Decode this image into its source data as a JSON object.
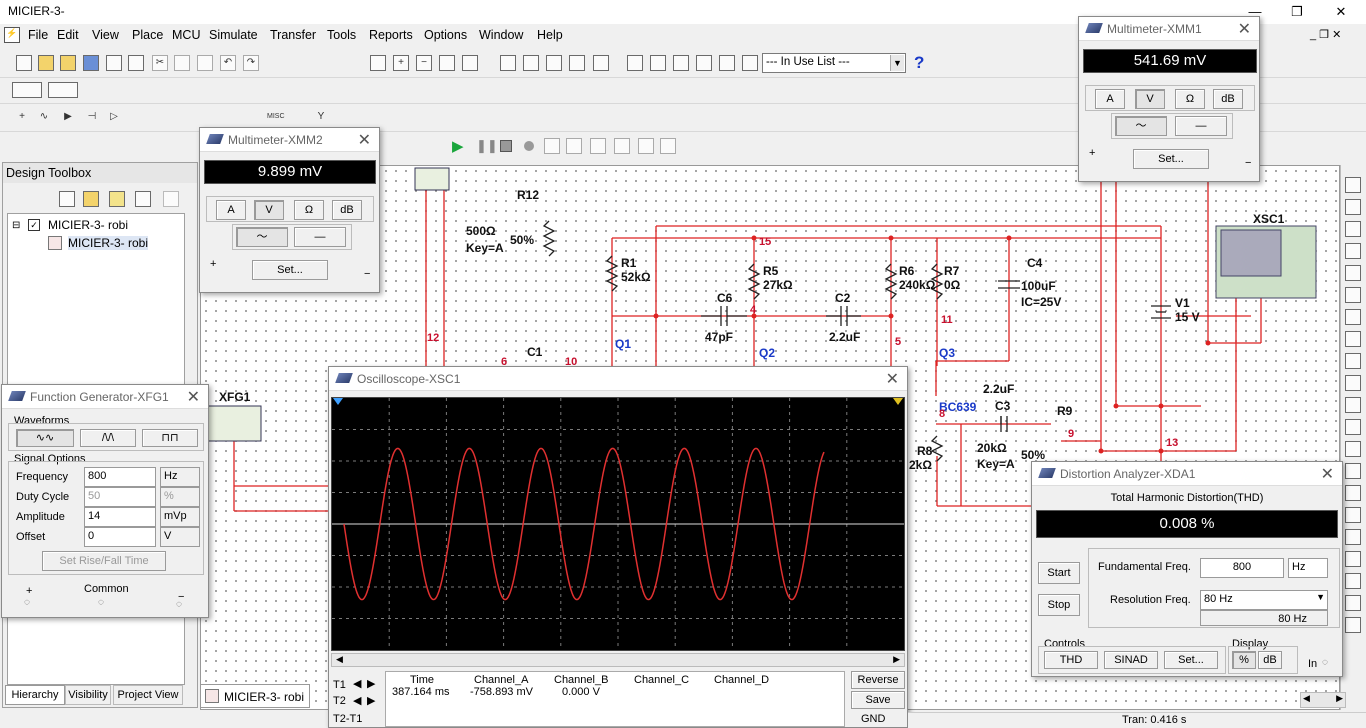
{
  "app": {
    "title": "MICIER-3-"
  },
  "menu": [
    "File",
    "Edit",
    "View",
    "Place",
    "MCU",
    "Simulate",
    "Transfer",
    "Tools",
    "Reports",
    "Options",
    "Window",
    "Help"
  ],
  "toolbar": {
    "in_use_list": "--- In Use List ---",
    "help": "?"
  },
  "toolbox": {
    "title": "Design Toolbox",
    "tree_root": "MICIER-3- robi",
    "tree_child": "MICIER-3- robi",
    "tabs": [
      "Hierarchy",
      "Visibility",
      "Project View"
    ]
  },
  "doc_tab": "MICIER-3- robi",
  "schematic": {
    "components": {
      "r12": "R12",
      "r12_val": "500Ω",
      "r12_key": "Key=A",
      "r12_pct": "50%",
      "r1": "R1",
      "r1_val": "52kΩ",
      "r5": "R5",
      "r5_val": "27kΩ",
      "r6": "R6",
      "r6_val": "240kΩ",
      "r7": "R7",
      "r7_val": "0Ω",
      "c4": "C4",
      "c4_val": "100uF",
      "c4_ic": "IC=25V",
      "c6": "C6",
      "c6_val": "47pF",
      "c2": "C2",
      "c2_val": "2.2uF",
      "c1": "C1",
      "q1": "Q1",
      "q2": "Q2",
      "q3": "Q3",
      "q3_model": "BC639",
      "v1": "V1",
      "v1_val": "15 V",
      "c3": "C3",
      "c3_val": "2.2uF",
      "r9": "R9",
      "r9_val": "20kΩ",
      "r9_key": "Key=A",
      "r9_pct": "50%",
      "r8": "R8",
      "r8_val": "2kΩ",
      "xfg1": "XFG1",
      "xsc1": "XSC1"
    },
    "nets": [
      "15",
      "4",
      "5",
      "11",
      "12",
      "6",
      "10",
      "9",
      "13",
      "8"
    ]
  },
  "xmm2": {
    "title": "Multimeter-XMM2",
    "reading": "9.899 mV",
    "modes": [
      "A",
      "V",
      "Ω",
      "dB"
    ],
    "settings": "Set...",
    "plus": "+",
    "minus": "−"
  },
  "xmm1": {
    "title": "Multimeter-XMM1",
    "reading": "541.69 mV",
    "modes": [
      "A",
      "V",
      "Ω",
      "dB"
    ],
    "settings": "Set...",
    "plus": "+",
    "minus": "−"
  },
  "fg": {
    "title": "Function Generator-XFG1",
    "waveforms_label": "Waveforms",
    "signal_options_label": "Signal Options",
    "frequency_label": "Frequency",
    "frequency_value": "800",
    "frequency_unit": "Hz",
    "duty_label": "Duty Cycle",
    "duty_value": "50",
    "duty_unit": "%",
    "amplitude_label": "Amplitude",
    "amplitude_value": "14",
    "amplitude_unit": "mVp",
    "offset_label": "Offset",
    "offset_value": "0",
    "offset_unit": "V",
    "rise_fall_button": "Set Rise/Fall Time",
    "common_label": "Common",
    "plus": "+",
    "minus": "−"
  },
  "scope": {
    "title": "Oscilloscope-XSC1",
    "trace_color": "#e03030",
    "cycles_shown": 6.7,
    "peak_fraction_of_height": 0.3,
    "headers": [
      "Time",
      "Channel_A",
      "Channel_B",
      "Channel_C",
      "Channel_D"
    ],
    "t1_label": "T1",
    "t2_label": "T2",
    "t2t1_label": "T2-T1",
    "time_value": "387.164 ms",
    "channel_a_value": "-758.893 mV",
    "channel_b_value": "0.000 V",
    "reverse_button": "Reverse",
    "save_button": "Save",
    "gnd_label": "GND"
  },
  "distortion": {
    "title": "Distortion Analyzer-XDA1",
    "heading": "Total Harmonic Distortion(THD)",
    "reading": "0.008 %",
    "start_button": "Start",
    "stop_button": "Stop",
    "fundamental_label": "Fundamental Freq.",
    "fundamental_value": "800",
    "fundamental_unit": "Hz",
    "resolution_label": "Resolution Freq.",
    "resolution_value": "80 Hz",
    "resolution_display": "80 Hz",
    "controls_label": "Controls",
    "thd_button": "THD",
    "sinad_button": "SINAD",
    "set_button": "Set...",
    "display_label": "Display",
    "percent_button": "%",
    "db_button": "dB",
    "in_label": "In"
  },
  "status": {
    "tran": "Tran: 0.416 s"
  }
}
